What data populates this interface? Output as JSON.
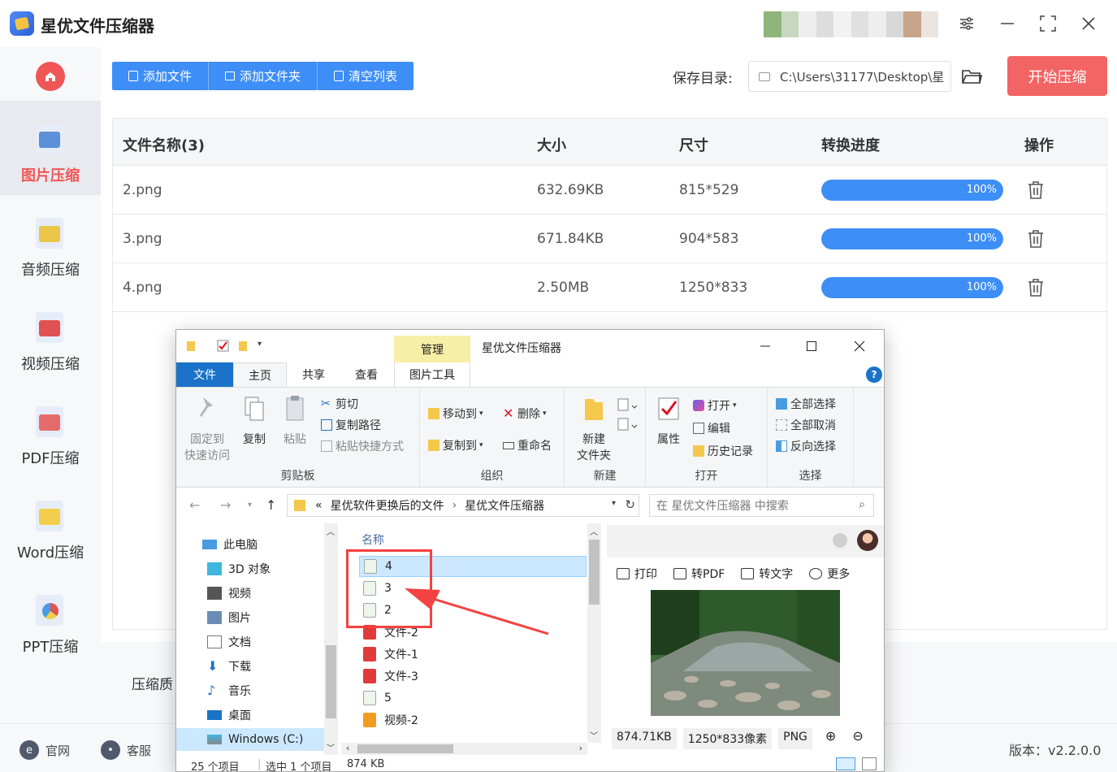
{
  "app": {
    "title": "星优文件压缩器",
    "accent": "#3e8ef7",
    "danger": "#f36464"
  },
  "sidebar": {
    "items": [
      {
        "label": "图片压缩",
        "icon": "image-icon",
        "active": true
      },
      {
        "label": "音频压缩",
        "icon": "music-icon",
        "active": false
      },
      {
        "label": "视频压缩",
        "icon": "video-icon",
        "active": false
      },
      {
        "label": "PDF压缩",
        "icon": "pdf-icon",
        "active": false
      },
      {
        "label": "Word压缩",
        "icon": "word-icon",
        "active": false
      },
      {
        "label": "PPT压缩",
        "icon": "ppt-icon",
        "active": false
      }
    ]
  },
  "toolbar": {
    "add_file": "添加文件",
    "add_folder": "添加文件夹",
    "clear_list": "清空列表",
    "save_dir_label": "保存目录:",
    "save_dir_value": "C:\\Users\\31177\\Desktop\\星",
    "start": "开始压缩"
  },
  "table": {
    "headers": {
      "name": "文件名称(3)",
      "size": "大小",
      "dims": "尺寸",
      "progress": "转换进度",
      "action": "操作"
    },
    "rows": [
      {
        "name": "2.png",
        "size": "632.69KB",
        "dims": "815*529",
        "progress": "100%",
        "progress_value": 1.0
      },
      {
        "name": "3.png",
        "size": "671.84KB",
        "dims": "904*583",
        "progress": "100%",
        "progress_value": 1.0
      },
      {
        "name": "4.png",
        "size": "2.50MB",
        "dims": "1250*833",
        "progress": "100%",
        "progress_value": 1.0
      }
    ]
  },
  "bottom": {
    "quality_label": "压缩质",
    "website": "官网",
    "service": "客服",
    "version": "版本：v2.2.0.0"
  },
  "explorer": {
    "title": "星优文件压缩器",
    "manage_tab": "管理",
    "tabs": [
      "文件",
      "主页",
      "共享",
      "查看",
      "图片工具"
    ],
    "ribbon": {
      "clipboard": {
        "label": "剪贴板",
        "pin": "固定到\n快速访问",
        "copy": "复制",
        "paste": "粘贴",
        "cut": "剪切",
        "copy_path": "复制路径",
        "paste_shortcut": "粘贴快捷方式"
      },
      "organize": {
        "label": "组织",
        "move_to": "移动到",
        "delete": "删除",
        "copy_to": "复制到",
        "rename": "重命名"
      },
      "new": {
        "label": "新建",
        "new_folder": "新建\n文件夹"
      },
      "open": {
        "label": "打开",
        "properties": "属性",
        "open": "打开",
        "edit": "编辑",
        "history": "历史记录"
      },
      "select": {
        "label": "选择",
        "select_all": "全部选择",
        "select_none": "全部取消",
        "invert": "反向选择"
      }
    },
    "address": {
      "prefix": "«",
      "parts": [
        "星优软件更换后的文件",
        "星优文件压缩器"
      ],
      "search_placeholder": "在 星优文件压缩器 中搜索"
    },
    "nav": [
      {
        "label": "此电脑",
        "icon": "computer-icon"
      },
      {
        "label": "3D 对象",
        "icon": "cube-icon"
      },
      {
        "label": "视频",
        "icon": "film-icon"
      },
      {
        "label": "图片",
        "icon": "picture-icon"
      },
      {
        "label": "文档",
        "icon": "document-icon"
      },
      {
        "label": "下载",
        "icon": "download-icon"
      },
      {
        "label": "音乐",
        "icon": "music-note-icon"
      },
      {
        "label": "桌面",
        "icon": "desktop-icon"
      },
      {
        "label": "Windows (C:)",
        "icon": "drive-icon"
      }
    ],
    "file_column": "名称",
    "files": [
      {
        "name": "4",
        "type": "png",
        "selected": true
      },
      {
        "name": "3",
        "type": "png",
        "selected": false
      },
      {
        "name": "2",
        "type": "png",
        "selected": false
      },
      {
        "name": "文件-2",
        "type": "pdf",
        "selected": false
      },
      {
        "name": "文件-1",
        "type": "pdf",
        "selected": false
      },
      {
        "name": "文件-3",
        "type": "pdf",
        "selected": false
      },
      {
        "name": "5",
        "type": "png",
        "selected": false
      },
      {
        "name": "视频-2",
        "type": "video",
        "selected": false
      }
    ],
    "preview": {
      "tools": [
        "打印",
        "转PDF",
        "转文字",
        "更多"
      ],
      "size": "874.71KB",
      "pixels": "1250*833像素",
      "format": "PNG"
    },
    "status": {
      "count": "25 个项目",
      "selected": "选中 1 个项目",
      "selected_size": "874 KB"
    }
  }
}
